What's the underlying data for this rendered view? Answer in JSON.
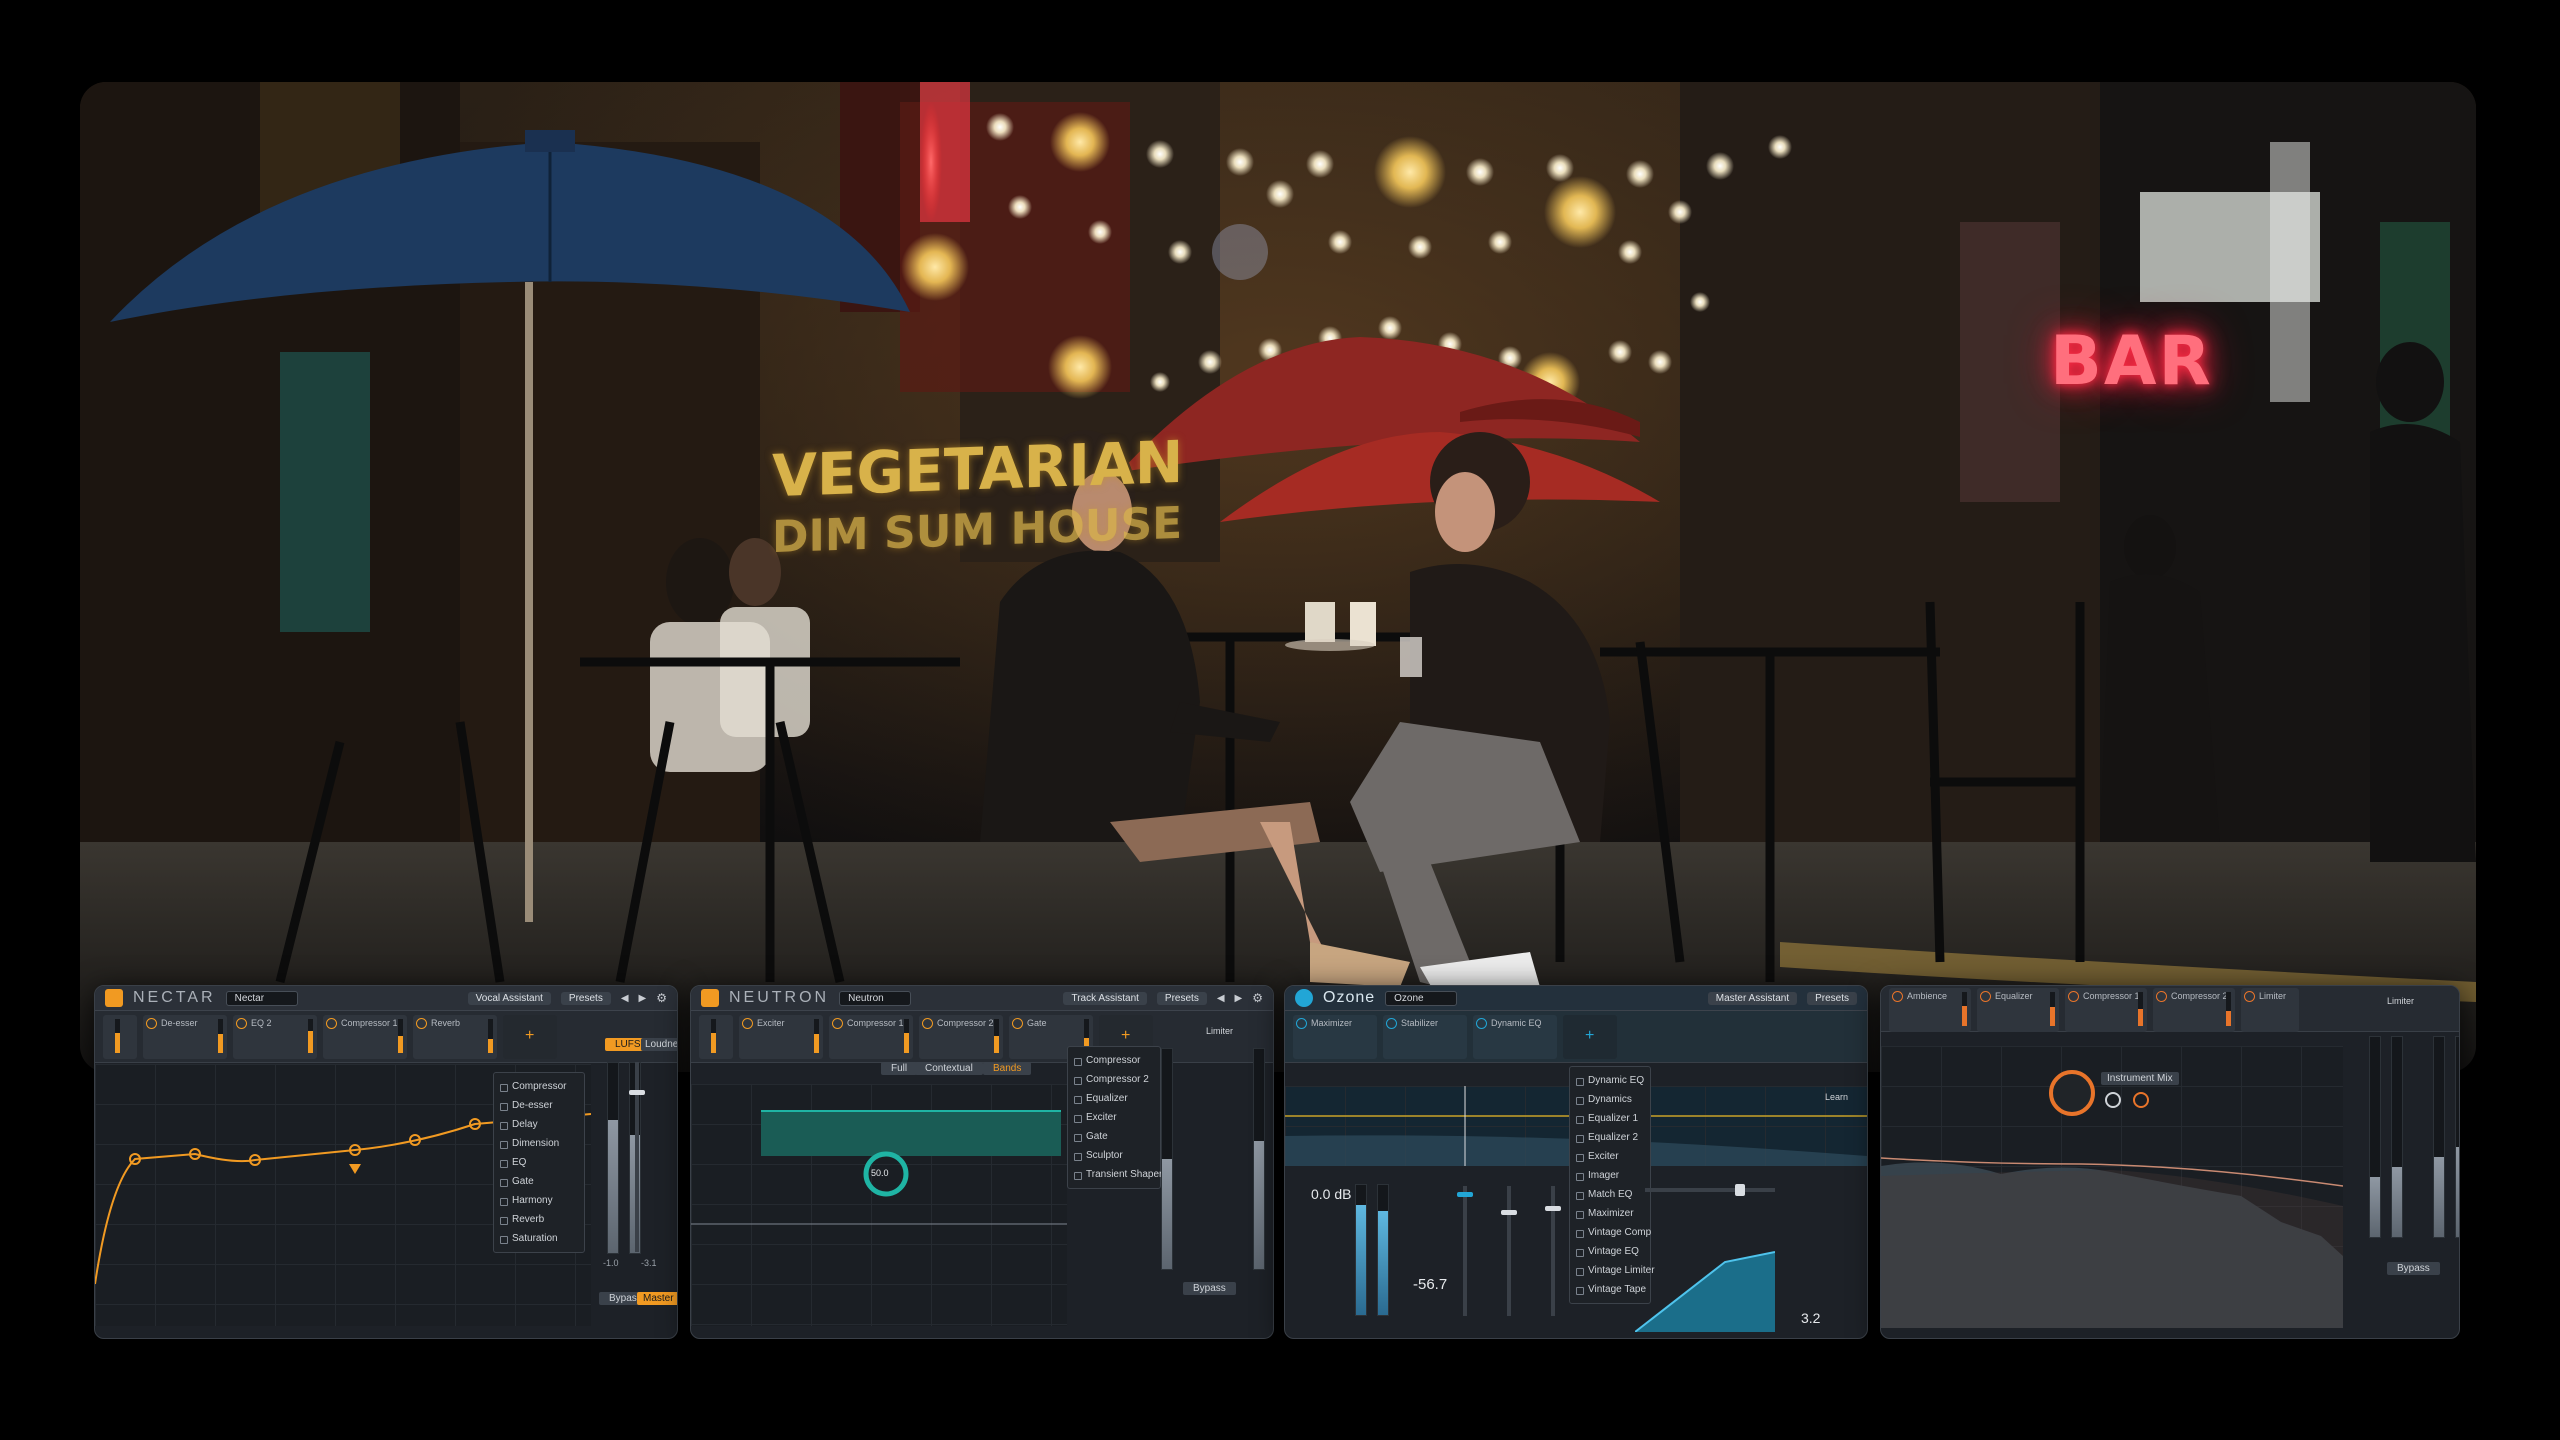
{
  "hero": {
    "bar_sign": "BAR",
    "vegetarian_sign_line1": "VEGETARIAN",
    "vegetarian_sign_line2": "DIM SUM HOUSE"
  },
  "nectar": {
    "brand": "NECTAR",
    "preset": "Nectar",
    "assistant_button": "Vocal Assistant",
    "presets_label": "Presets",
    "modules": [
      "De-esser",
      "EQ 2",
      "Compressor 1",
      "Reverb"
    ],
    "right_labels": [
      "LUFS",
      "Loudness"
    ],
    "menu": [
      "Compressor",
      "De-esser",
      "Delay",
      "Dimension",
      "EQ",
      "Gate",
      "Harmony",
      "Reverb",
      "Saturation"
    ],
    "bottom_buttons": [
      "Bypass",
      "Master"
    ],
    "meter_values": [
      "-1.0",
      "-3.1"
    ],
    "eq_color": "#f19a22"
  },
  "neutron": {
    "brand": "NEUTRON",
    "preset": "Neutron",
    "assistant_button": "Track Assistant",
    "presets_label": "Presets",
    "modules": [
      "Exciter",
      "Compressor 1",
      "Compressor 2",
      "Gate"
    ],
    "menu": [
      "Compressor",
      "Compressor 2",
      "Equalizer",
      "Exciter",
      "Gate",
      "Sculptor",
      "Transient Shaper"
    ],
    "tabs": [
      "Full",
      "Contextual",
      "Bands"
    ],
    "limiter_label": "Limiter",
    "bottom_button": "Bypass",
    "knob_value": "50.0",
    "accent": "#f19a22",
    "teal": "#1fb4a4"
  },
  "ozone": {
    "brand": "Ozone",
    "preset": "Ozone",
    "assistant_button": "Master Assistant",
    "presets_label": "Presets",
    "modules": [
      "Maximizer",
      "Stabilizer",
      "Dynamic EQ"
    ],
    "menu": [
      "Dynamic EQ",
      "Dynamics",
      "Equalizer 1",
      "Equalizer 2",
      "Exciter",
      "Imager",
      "Match EQ",
      "Maximizer",
      "Vintage Comp",
      "Vintage EQ",
      "Vintage Limiter",
      "Vintage Tape"
    ],
    "learn_label": "Learn",
    "gain_readout": "0.0 dB",
    "peak_readout": "-56.7",
    "right_value": "3.2",
    "accent": "#22a6d6"
  },
  "fourth": {
    "modules": [
      "Ambience",
      "Equalizer",
      "Compressor 1",
      "Compressor 2",
      "Limiter"
    ],
    "center_label": "Instrument Mix",
    "limiter_label": "Limiter",
    "bottom_button": "Bypass",
    "accent": "#e8742a"
  }
}
